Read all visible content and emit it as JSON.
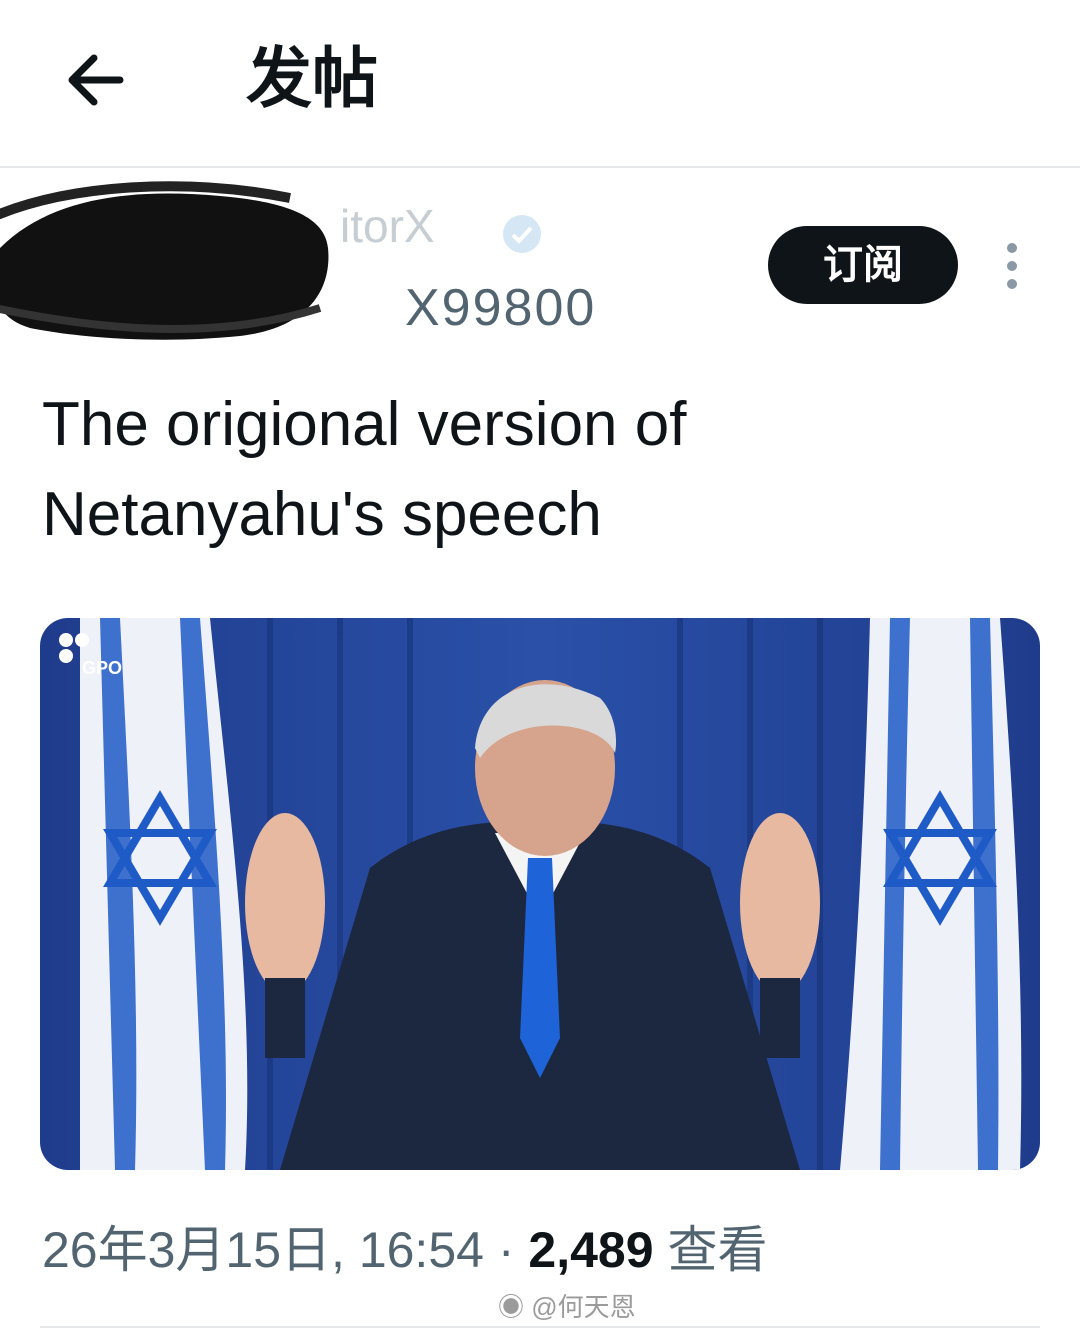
{
  "header": {
    "title": "发帖",
    "back_icon": "arrow-left-icon"
  },
  "author": {
    "display_name": "itorX",
    "handle": "X99800",
    "verified_icon": "verified-badge-icon",
    "subscribe_label": "订阅",
    "more_icon": "more-vertical-icon"
  },
  "tweet": {
    "text_line1": "The origional version of",
    "text_line2": "Netanyahu's speech"
  },
  "media": {
    "logo_text": "GPO"
  },
  "meta": {
    "timestamp": "26年3月15日, 16:54",
    "separator": "·",
    "views_count": "2,489",
    "views_label": "查看"
  },
  "watermark": {
    "text": "@何天恩",
    "icon": "weibo-logo-icon"
  },
  "colors": {
    "text": "#0f1419",
    "secondary": "#536471",
    "divider": "#e6e8ea",
    "button": "#0f1419"
  }
}
